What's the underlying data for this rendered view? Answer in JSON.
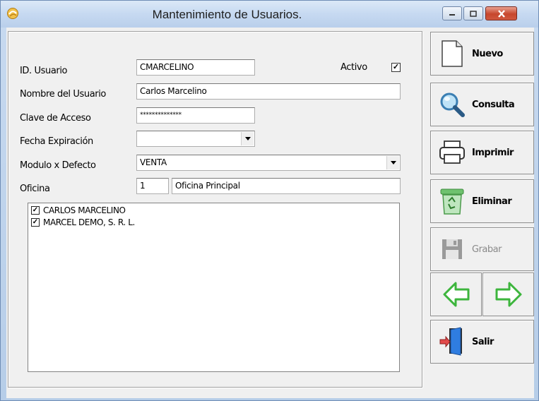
{
  "window": {
    "title": "Mantenimiento de Usuarios."
  },
  "form": {
    "id_label": "ID. Usuario",
    "id_value": "CMARCELINO",
    "active_label": "Activo",
    "active_checked": true,
    "name_label": "Nombre del  Usuario",
    "name_value": "Carlos Marcelino",
    "password_label": "Clave de Acceso",
    "password_value": "**************",
    "expiration_label": "Fecha Expiración",
    "expiration_value": "",
    "module_label": "Modulo x Defecto",
    "module_value": "VENTA",
    "office_label": "Oficina",
    "office_code": "1",
    "office_name": "Oficina Principal"
  },
  "companies": [
    {
      "label": "CARLOS MARCELINO",
      "checked": true
    },
    {
      "label": "MARCEL DEMO, S. R. L.",
      "checked": true
    }
  ],
  "toolbar": {
    "new_label": "Nuevo",
    "query_label": "Consulta",
    "print_label": "Imprimir",
    "delete_label": "Eliminar",
    "save_label": "Grabar",
    "exit_label": "Salir"
  },
  "icons": {
    "new": "document-icon",
    "query": "magnifier-icon",
    "print": "printer-icon",
    "delete": "recycle-bin-icon",
    "save": "floppy-icon",
    "prev": "arrow-left-icon",
    "next": "arrow-right-icon",
    "exit": "door-exit-icon"
  },
  "colors": {
    "arrow_green": "#3db53d",
    "close_red": "#c7462c"
  }
}
